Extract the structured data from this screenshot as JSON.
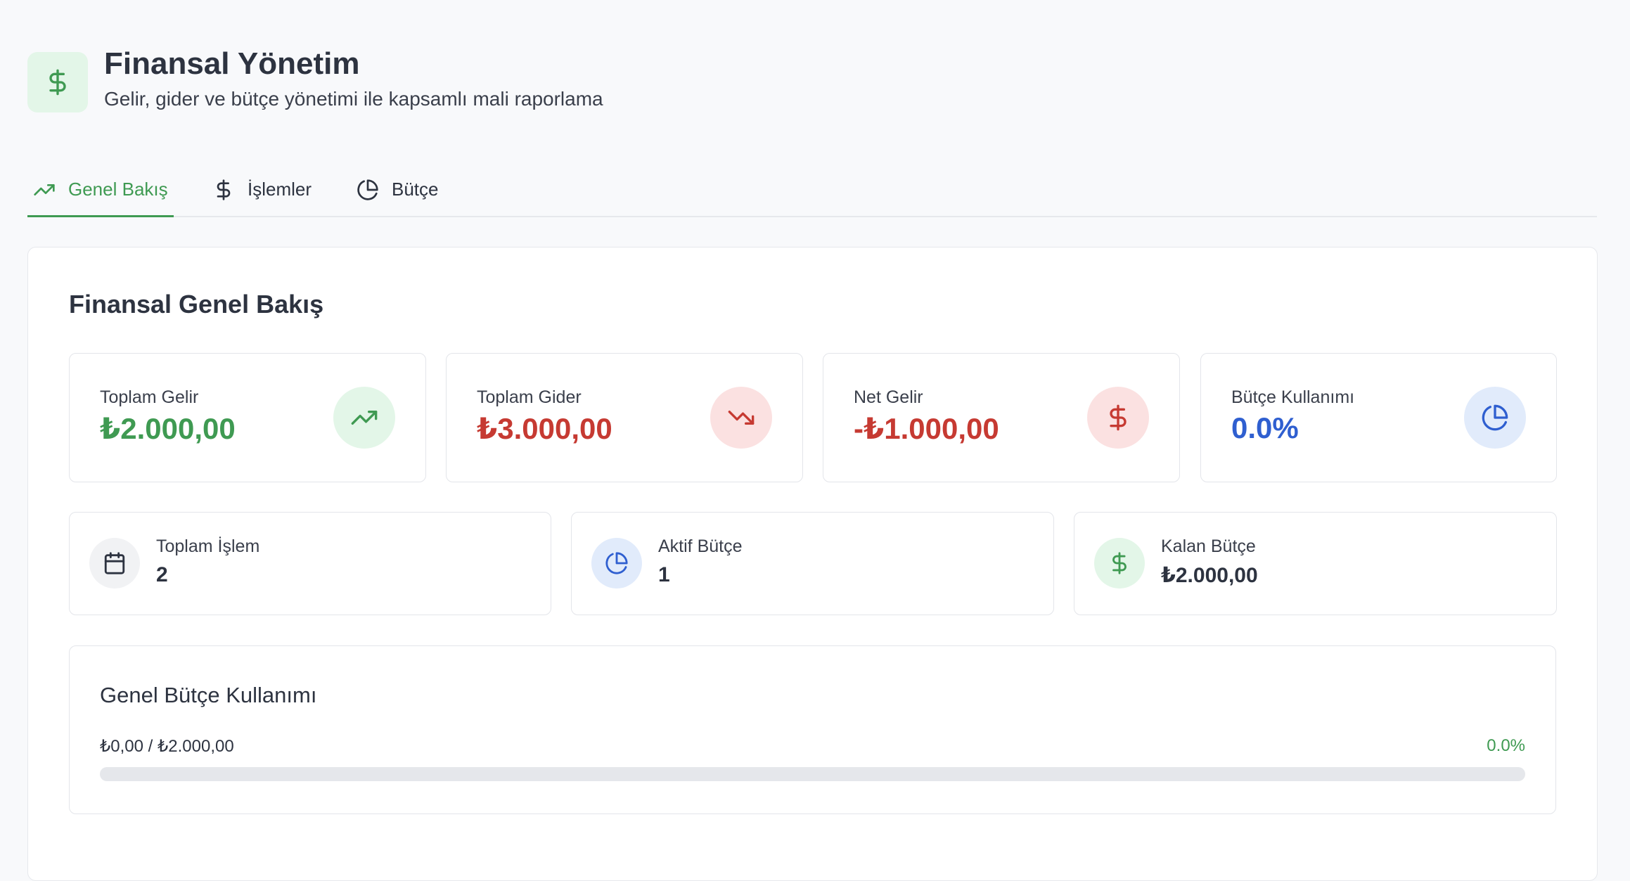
{
  "header": {
    "icon": "dollar-icon",
    "title": "Finansal Yönetim",
    "subtitle": "Gelir, gider ve bütçe yönetimi ile kapsamlı mali raporlama"
  },
  "tabs": [
    {
      "label": "Genel Bakış",
      "icon": "trending-up-icon",
      "active": true
    },
    {
      "label": "İşlemler",
      "icon": "dollar-icon",
      "active": false
    },
    {
      "label": "Bütçe",
      "icon": "pie-chart-icon",
      "active": false
    }
  ],
  "overview": {
    "title": "Finansal Genel Bakış",
    "stats": [
      {
        "label": "Toplam Gelir",
        "value": "₺2.000,00",
        "color": "#3f9a52",
        "icon": "trending-up-icon",
        "icon_bg": "#e3f6e8"
      },
      {
        "label": "Toplam Gider",
        "value": "₺3.000,00",
        "color": "#c63a32",
        "icon": "trending-down-icon",
        "icon_bg": "#fbe1e1"
      },
      {
        "label": "Net Gelir",
        "value": "-₺1.000,00",
        "color": "#c63a32",
        "icon": "dollar-icon",
        "icon_bg": "#fbe1e1"
      },
      {
        "label": "Bütçe Kullanımı",
        "value": "0.0%",
        "color": "#2f5fd0",
        "icon": "pie-chart-icon",
        "icon_bg": "#e1ebfb"
      }
    ],
    "mini": [
      {
        "label": "Toplam İşlem",
        "value": "2",
        "icon": "calendar-icon",
        "icon_bg": "#f1f2f4"
      },
      {
        "label": "Aktif Bütçe",
        "value": "1",
        "icon": "pie-chart-icon",
        "icon_bg": "#e1ebfb"
      },
      {
        "label": "Kalan Bütçe",
        "value": "₺2.000,00",
        "icon": "dollar-icon",
        "icon_bg": "#e3f6e8"
      }
    ],
    "budget": {
      "title": "Genel Bütçe Kullanımı",
      "amount": "₺0,00 / ₺2.000,00",
      "percent": "0.0%",
      "progress": 0.0
    }
  }
}
